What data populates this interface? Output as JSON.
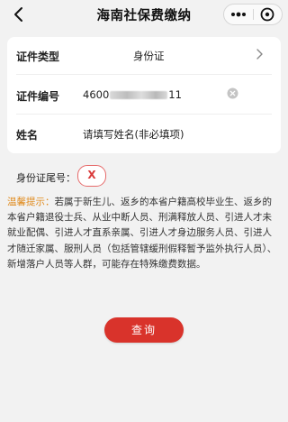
{
  "header": {
    "title": "海南社保费缴纳"
  },
  "form": {
    "cert_type": {
      "label": "证件类型",
      "value": "身份证"
    },
    "cert_number": {
      "label": "证件编号",
      "prefix": "4600",
      "suffix": "11"
    },
    "name": {
      "label": "姓名",
      "placeholder": "请填写姓名(非必填项)"
    }
  },
  "tail": {
    "label": "身份证尾号：",
    "value": "X"
  },
  "notice": {
    "title": "温馨提示：",
    "text": "若属于新生儿、返乡的本省户籍高校毕业生、返乡的本省户籍退役士兵、从业中断人员、刑满释放人员、引进人才未就业配偶、引进人才直系亲属、引进人才身边服务人员、引进人才随迁家属、服刑人员（包括管辖缓刑假释暂予监外执行人员）、新增落户人员等人群，可能存在特殊缴费数据。"
  },
  "actions": {
    "query_label": "查询"
  },
  "icons": {
    "back": "back-arrow-icon",
    "more": "more-dots-icon",
    "close": "close-circle-icon",
    "chevron": "chevron-right-icon",
    "clear": "clear-circle-icon"
  },
  "colors": {
    "primary": "#d9332b",
    "tip": "#e08b1e"
  }
}
